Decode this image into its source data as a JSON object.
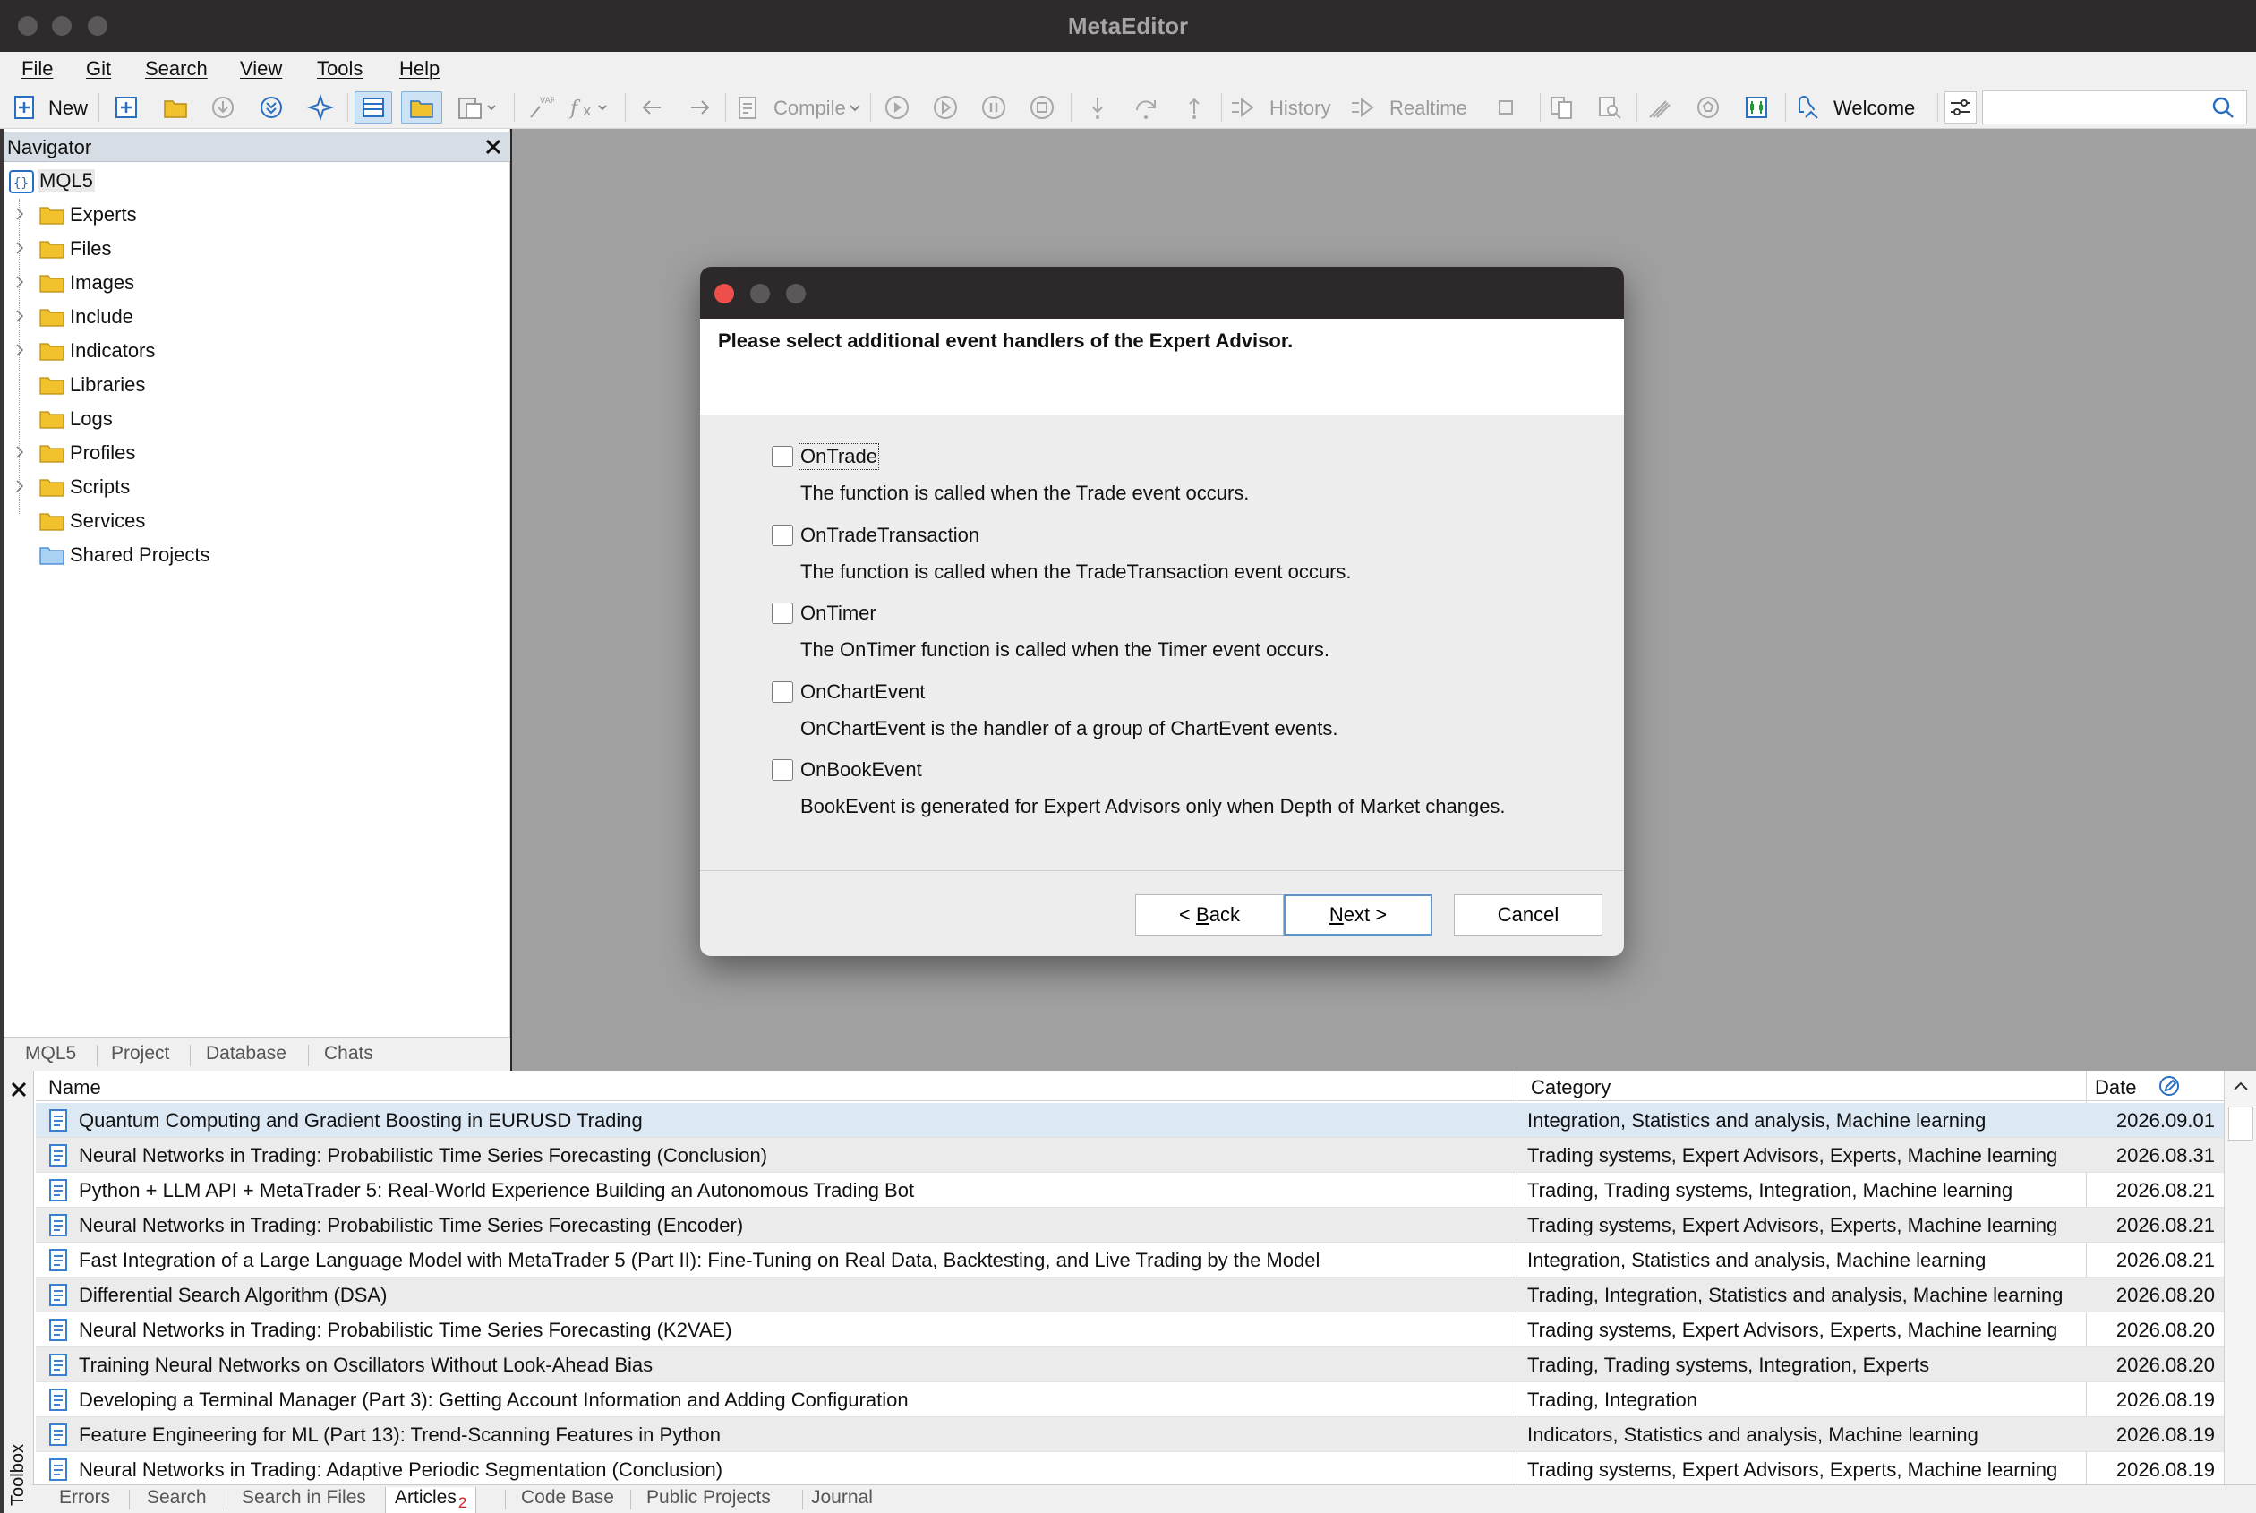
{
  "window": {
    "title": "MetaEditor"
  },
  "menu": [
    "File",
    "Git",
    "Search",
    "View",
    "Tools",
    "Help"
  ],
  "toolbar": {
    "new_label": "New",
    "compile_label": "Compile",
    "history_label": "History",
    "realtime_label": "Realtime",
    "welcome_label": "Welcome",
    "search_placeholder": ""
  },
  "navigator": {
    "title": "Navigator",
    "root": "MQL5",
    "items": [
      "Experts",
      "Files",
      "Images",
      "Include",
      "Indicators",
      "Libraries",
      "Logs",
      "Profiles",
      "Scripts",
      "Services",
      "Shared Projects"
    ],
    "tabs": [
      "MQL5",
      "Project",
      "Database",
      "Chats"
    ]
  },
  "dialog": {
    "heading": "Please select additional event handlers of the Expert Advisor.",
    "options": [
      {
        "label": "OnTrade",
        "description": "The function is called when the Trade event occurs.",
        "checked": false
      },
      {
        "label": "OnTradeTransaction",
        "description": "The function is called when the TradeTransaction event occurs.",
        "checked": false
      },
      {
        "label": "OnTimer",
        "description": "The OnTimer function is called when the Timer event occurs.",
        "checked": false
      },
      {
        "label": "OnChartEvent",
        "description": "OnChartEvent is the handler of a group of ChartEvent events.",
        "checked": false
      },
      {
        "label": "OnBookEvent",
        "description": "BookEvent is generated for Expert Advisors only when Depth of Market changes.",
        "checked": false
      }
    ],
    "back_prefix": "< ",
    "back_key": "B",
    "back_rest": "ack",
    "next_key": "N",
    "next_rest": "ext >",
    "cancel_label": "Cancel"
  },
  "toolbox": {
    "side_label": "Toolbox",
    "columns": {
      "name": "Name",
      "category": "Category",
      "date": "Date"
    },
    "rows": [
      {
        "name": "Quantum Computing and Gradient Boosting in EURUSD Trading",
        "category": "Integration, Statistics and analysis, Machine learning",
        "date": "2026.09.01"
      },
      {
        "name": "Neural Networks in Trading: Probabilistic Time Series Forecasting (Conclusion)",
        "category": "Trading systems, Expert Advisors, Experts, Machine learning",
        "date": "2026.08.31"
      },
      {
        "name": "Python + LLM API + MetaTrader 5: Real-World Experience Building an Autonomous Trading Bot",
        "category": "Trading, Trading systems, Integration, Machine learning",
        "date": "2026.08.21"
      },
      {
        "name": "Neural Networks in Trading: Probabilistic Time Series Forecasting (Encoder)",
        "category": "Trading systems, Expert Advisors, Experts, Machine learning",
        "date": "2026.08.21"
      },
      {
        "name": "Fast Integration of a Large Language Model with MetaTrader 5 (Part II): Fine-Tuning on Real Data, Backtesting, and Live Trading by the Model",
        "category": "Integration, Statistics and analysis, Machine learning",
        "date": "2026.08.21"
      },
      {
        "name": "Differential Search Algorithm (DSA)",
        "category": "Trading, Integration, Statistics and analysis, Machine learning",
        "date": "2026.08.20"
      },
      {
        "name": "Neural Networks in Trading: Probabilistic Time Series Forecasting (K2VAE)",
        "category": "Trading systems, Expert Advisors, Experts, Machine learning",
        "date": "2026.08.20"
      },
      {
        "name": "Training Neural Networks on Oscillators Without Look-Ahead Bias",
        "category": "Trading, Trading systems, Integration, Experts",
        "date": "2026.08.20"
      },
      {
        "name": "Developing a Terminal Manager (Part 3): Getting Account Information and Adding Configuration",
        "category": "Trading, Integration",
        "date": "2026.08.19"
      },
      {
        "name": "Feature Engineering for ML (Part 13): Trend-Scanning Features in Python",
        "category": "Indicators, Statistics and analysis, Machine learning",
        "date": "2026.08.19"
      },
      {
        "name": "Neural Networks in Trading: Adaptive Periodic Segmentation (Conclusion)",
        "category": "Trading systems, Expert Advisors, Experts, Machine learning",
        "date": "2026.08.19"
      }
    ],
    "tabs": [
      "Errors",
      "Search",
      "Search in Files",
      "Articles",
      "Code Base",
      "Public Projects",
      "Journal"
    ],
    "articles_badge": "2",
    "active_tab": "Articles"
  },
  "colors": {
    "titlebar": "#2f2a2b",
    "workspace": "#a0a0a0",
    "dialog_close": "#ee4f4b",
    "folder": "#f2c12e",
    "doc_icon": "#3a7fd0",
    "badge": "#d42020",
    "selection": "#dde8f5"
  }
}
